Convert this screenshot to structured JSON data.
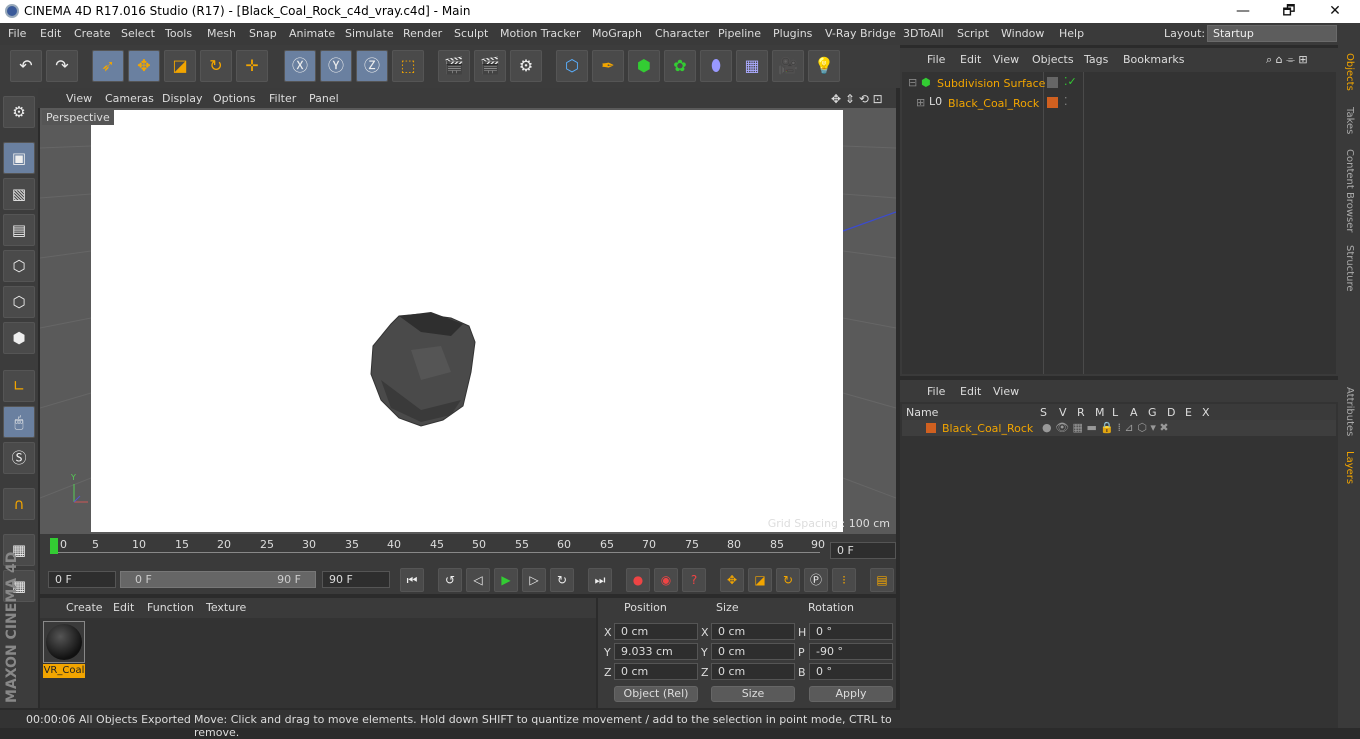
{
  "window": {
    "title": "CINEMA 4D R17.016 Studio (R17) - [Black_Coal_Rock_c4d_vray.c4d] - Main",
    "minimize": "—",
    "maximize": "🗗",
    "close": "✕"
  },
  "menubar": {
    "items": [
      "File",
      "Edit",
      "Create",
      "Select",
      "Tools",
      "Mesh",
      "Snap",
      "Animate",
      "Simulate",
      "Render",
      "Sculpt",
      "Motion Tracker",
      "MoGraph",
      "Character",
      "Pipeline",
      "Plugins",
      "V-Ray Bridge",
      "3DToAll",
      "Script",
      "Window",
      "Help"
    ],
    "layout_label": "Layout:",
    "layout_value": "Startup"
  },
  "viewport": {
    "menu": [
      "View",
      "Cameras",
      "Display",
      "Options",
      "Filter",
      "Panel"
    ],
    "camera": "Perspective",
    "grid_spacing": "Grid Spacing : 100 cm"
  },
  "timeline": {
    "ticks": [
      "0",
      "5",
      "10",
      "15",
      "20",
      "25",
      "30",
      "35",
      "40",
      "45",
      "50",
      "55",
      "60",
      "65",
      "70",
      "75",
      "80",
      "85",
      "90"
    ],
    "current_frame": "0 F",
    "start_frame": "0 F",
    "range_start": "0 F",
    "range_end": "90 F",
    "end_frame": "90 F"
  },
  "material": {
    "menu": [
      "Create",
      "Edit",
      "Function",
      "Texture"
    ],
    "name": "VR_Coal"
  },
  "coords": {
    "headers": [
      "Position",
      "Size",
      "Rotation"
    ],
    "pos": {
      "x": "0 cm",
      "y": "9.033 cm",
      "z": "0 cm"
    },
    "size": {
      "x": "0 cm",
      "y": "0 cm",
      "z": "0 cm"
    },
    "rot": {
      "h": "0 °",
      "p": "-90 °",
      "b": "0 °"
    },
    "axis_labels": {
      "x": "X",
      "y": "Y",
      "z": "Z",
      "h": "H",
      "p": "P",
      "b": "B"
    },
    "mode": "Object (Rel)",
    "size_mode": "Size",
    "apply": "Apply"
  },
  "status": {
    "time": "00:00:06 All Objects Exported",
    "hint": "Move: Click and drag to move elements. Hold down SHIFT to quantize movement / add to the selection in point mode, CTRL to remove."
  },
  "object_manager": {
    "menu": [
      "File",
      "Edit",
      "View",
      "Objects",
      "Tags",
      "Bookmarks"
    ],
    "objects": [
      "Subdivision Surface",
      "Black_Coal_Rock"
    ]
  },
  "layer_manager": {
    "menu": [
      "File",
      "Edit",
      "View"
    ],
    "columns": [
      "Name",
      "S",
      "V",
      "R",
      "M",
      "L",
      "A",
      "G",
      "D",
      "E",
      "X"
    ],
    "layer": "Black_Coal_Rock"
  },
  "side_tabs": [
    "Objects",
    "Takes",
    "Content Browser",
    "Structure",
    "Attributes",
    "Layers"
  ],
  "brand": "MAXON CINEMA 4D",
  "colors": {
    "accent": "#f2a500",
    "active_tool": "#6a80a0",
    "background": "#3a3a3a"
  }
}
